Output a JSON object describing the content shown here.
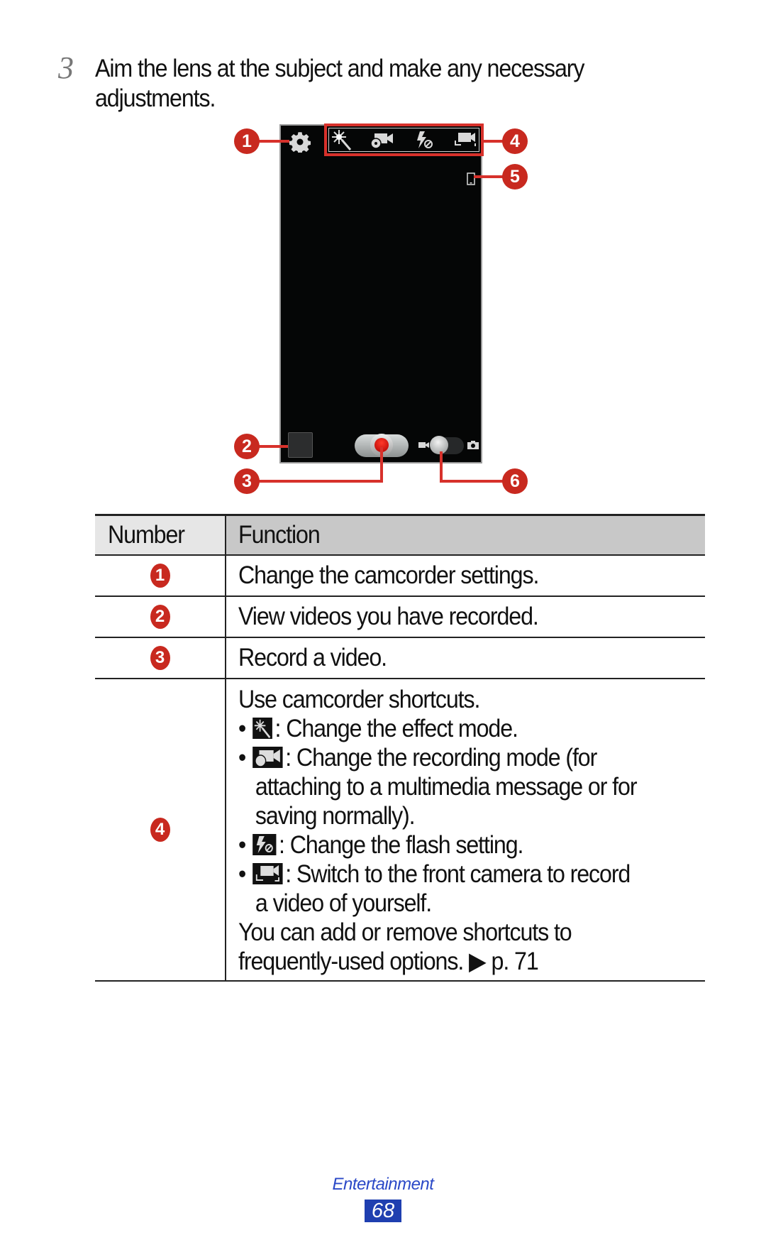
{
  "step": {
    "number": "3",
    "text": "Aim the lens at the subject and make any necessary adjustments."
  },
  "figure": {
    "callouts": [
      "1",
      "2",
      "3",
      "4",
      "5",
      "6"
    ],
    "icons": {
      "settings": "gear-icon",
      "effect": "magic-wand-icon",
      "recording_mode": "video-camera-reel-icon",
      "flash": "flash-off-icon",
      "switch_camera": "switch-camera-icon",
      "storage": "phone-storage-icon",
      "gallery": "thumbnail-icon",
      "record": "record-icon",
      "mode_video": "video-camera-icon",
      "mode_photo": "camera-icon"
    },
    "accent_color": "#d7312b",
    "record_color": "#d00000"
  },
  "table": {
    "headers": [
      "Number",
      "Function"
    ],
    "rows": [
      {
        "number": "1",
        "function": "Change the camcorder settings."
      },
      {
        "number": "2",
        "function": "View videos you have recorded."
      },
      {
        "number": "3",
        "function": "Record a video."
      },
      {
        "number": "4",
        "intro": "Use camcorder shortcuts.",
        "bullets": [
          {
            "icon": "magic-wand-icon",
            "lines": [
              ": Change the effect mode."
            ]
          },
          {
            "icon": "video-camera-reel-icon",
            "lines": [
              ": Change the recording mode (for",
              "attaching to a multimedia message or for",
              "saving normally)."
            ]
          },
          {
            "icon": "flash-off-icon",
            "lines": [
              ": Change the flash setting."
            ]
          },
          {
            "icon": "switch-camera-icon",
            "lines": [
              ": Switch to the front camera to record",
              "a video of yourself."
            ]
          }
        ],
        "outro": [
          "You can add or remove shortcuts to",
          "frequently-used options. ▶ p. 71"
        ]
      }
    ]
  },
  "footer": {
    "section": "Entertainment",
    "page": "68"
  }
}
